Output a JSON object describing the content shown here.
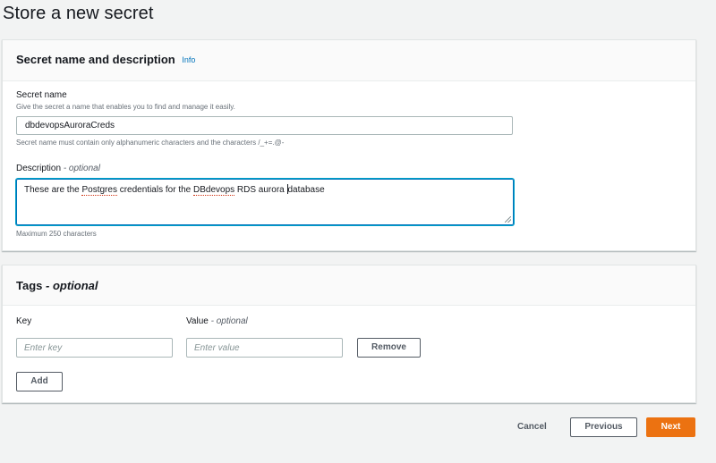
{
  "page": {
    "title": "Store a new secret"
  },
  "secret_section": {
    "header": "Secret name and description",
    "info_link": "Info",
    "name_label": "Secret name",
    "name_hint": "Give the secret a name that enables you to find and manage it easily.",
    "name_value": "dbdevopsAuroraCreds",
    "name_constraint": "Secret name must contain only alphanumeric characters and the characters /_+=.@-",
    "description_label": "Description",
    "description_optional": "- optional",
    "description_value": {
      "p1": "These are the ",
      "w1": "Postgres",
      "p2": " credentials for the ",
      "w2": "DBdevops",
      "p3": " RDS aurora ",
      "p4": "database"
    },
    "description_limit": "Maximum 250 characters"
  },
  "tags_section": {
    "header_main": "Tags",
    "header_optional": "- optional",
    "key_label": "Key",
    "value_label": "Value",
    "value_optional": "- optional",
    "key_placeholder": "Enter key",
    "value_placeholder": "Enter value",
    "remove_label": "Remove",
    "add_label": "Add"
  },
  "footer": {
    "cancel_label": "Cancel",
    "previous_label": "Previous",
    "next_label": "Next"
  },
  "colors": {
    "primary_button": "#ec7211",
    "link": "#0073bb",
    "focus_border": "#0073bb"
  }
}
